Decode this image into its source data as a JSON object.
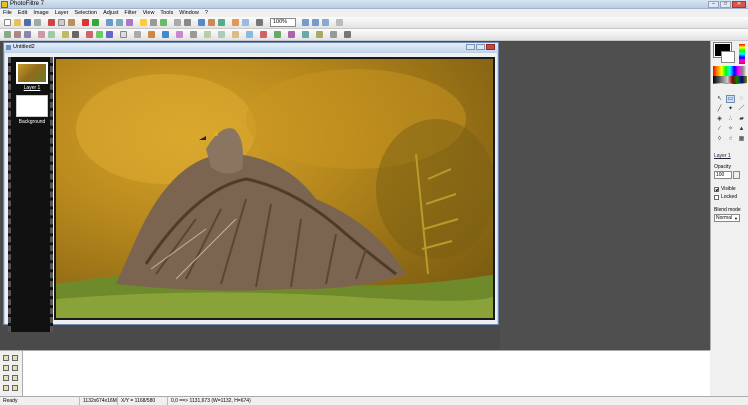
{
  "app": {
    "title": "PhotoFiltre 7"
  },
  "window_controls": {
    "minimize": "–",
    "maximize": "□",
    "close": "✕"
  },
  "menu": [
    "File",
    "Edit",
    "Image",
    "Layer",
    "Selection",
    "Adjust",
    "Filter",
    "View",
    "Tools",
    "Window",
    "?"
  ],
  "toolbar": {
    "zoom": "100%"
  },
  "document": {
    "title": "Untitled2"
  },
  "layers": [
    {
      "label": "Layer 1",
      "selected": true
    },
    {
      "label": "Background",
      "selected": false
    }
  ],
  "right_panel": {
    "layer_name": "Layer 1",
    "opacity_label": "Opacity",
    "opacity_value": "100",
    "visible_label": "Visible",
    "visible_checked": true,
    "locked_label": "Locked",
    "locked_checked": false,
    "blend_label": "Blend mode",
    "blend_value": "Normal",
    "fg_color": "#000000",
    "bg_color": "#ffffff"
  },
  "tools": [
    "pointer-icon",
    "select-rect-icon",
    "lasso-icon",
    "eyedropper-icon",
    "wand-icon",
    "line-icon",
    "bucket-icon",
    "spray-icon",
    "eraser-icon",
    "brush-icon",
    "clone-icon",
    "stamp-icon",
    "drop-icon",
    "smudge-icon",
    "gradient-icon"
  ],
  "status": {
    "state": "Ready",
    "size": "1132x674x16M",
    "zoom": "X/Y = 1168/580",
    "selection": "0,0 ==> 1131,673 (W=1132, H=674)"
  }
}
